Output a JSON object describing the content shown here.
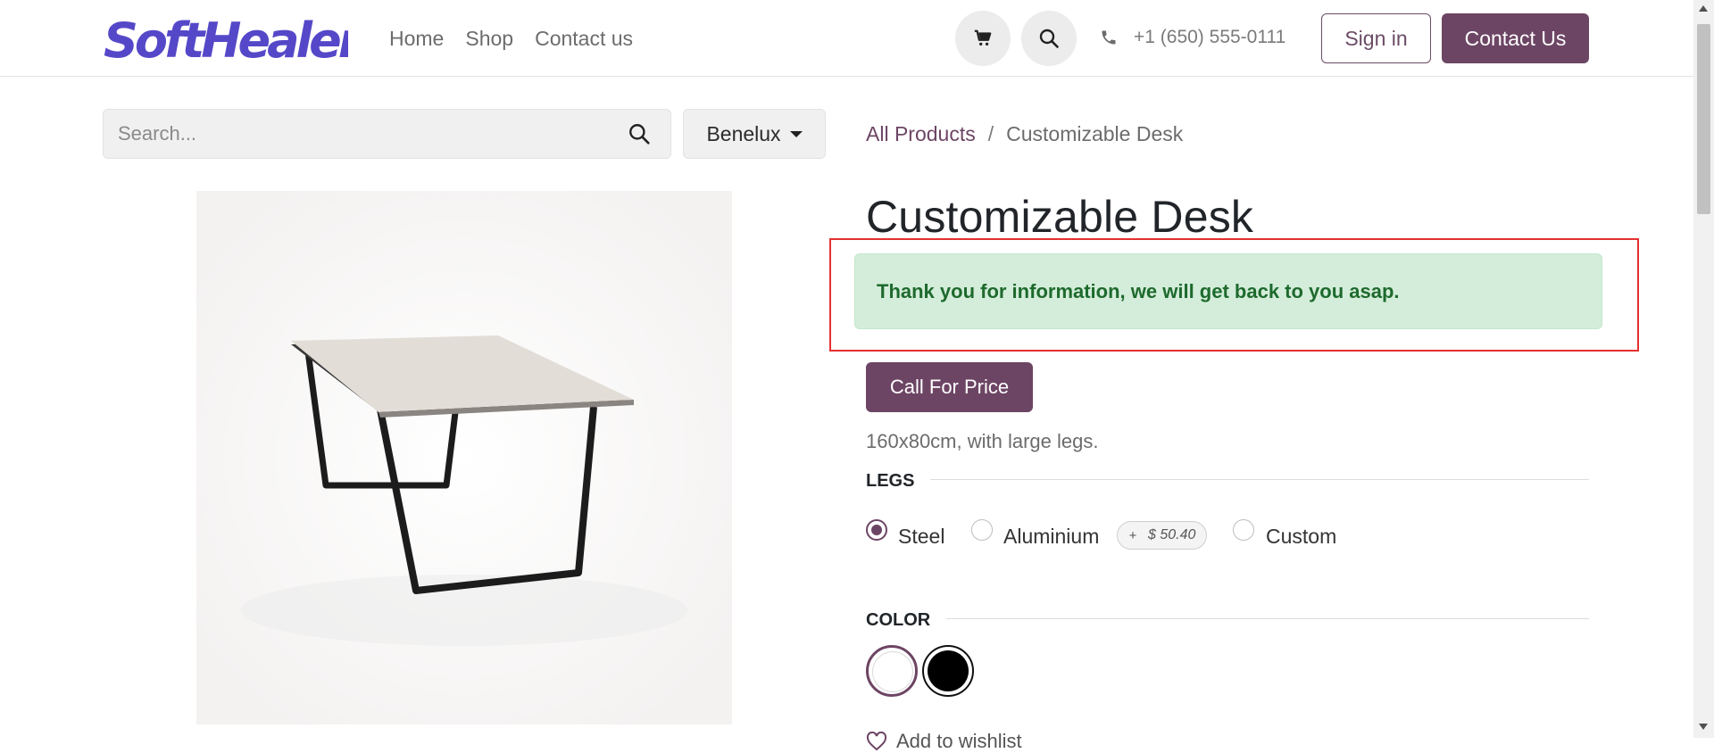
{
  "header": {
    "logo_text": "SoftHealer",
    "nav": [
      {
        "label": "Home"
      },
      {
        "label": "Shop"
      },
      {
        "label": "Contact us"
      }
    ],
    "phone": "+1 (650) 555-0111",
    "sign_in_label": "Sign in",
    "contact_label": "Contact Us",
    "brand_color": "#6d4564",
    "logo_color": "#5548c8"
  },
  "search": {
    "placeholder": "Search...",
    "value": ""
  },
  "pricelist": {
    "selected": "Benelux"
  },
  "breadcrumb": {
    "parent": "All Products",
    "separator": "/",
    "current": "Customizable Desk"
  },
  "product": {
    "name": "Customizable Desk",
    "alert_message": "Thank you for information, we will get back to you asap.",
    "call_for_price_label": "Call For Price",
    "description": "160x80cm, with large legs.",
    "legs": {
      "label": "LEGS",
      "options": [
        {
          "label": "Steel",
          "selected": true
        },
        {
          "label": "Aluminium",
          "selected": false,
          "extra_price": "$ 50.40"
        },
        {
          "label": "Custom",
          "selected": false
        }
      ]
    },
    "color": {
      "label": "COLOR",
      "options": [
        {
          "name": "white",
          "selected": true
        },
        {
          "name": "black",
          "selected": false
        }
      ]
    },
    "wishlist_label": "Add to wishlist"
  },
  "icons": {
    "cart": "cart-icon",
    "search": "search-icon",
    "phone": "phone-icon",
    "heart": "heart-icon"
  }
}
